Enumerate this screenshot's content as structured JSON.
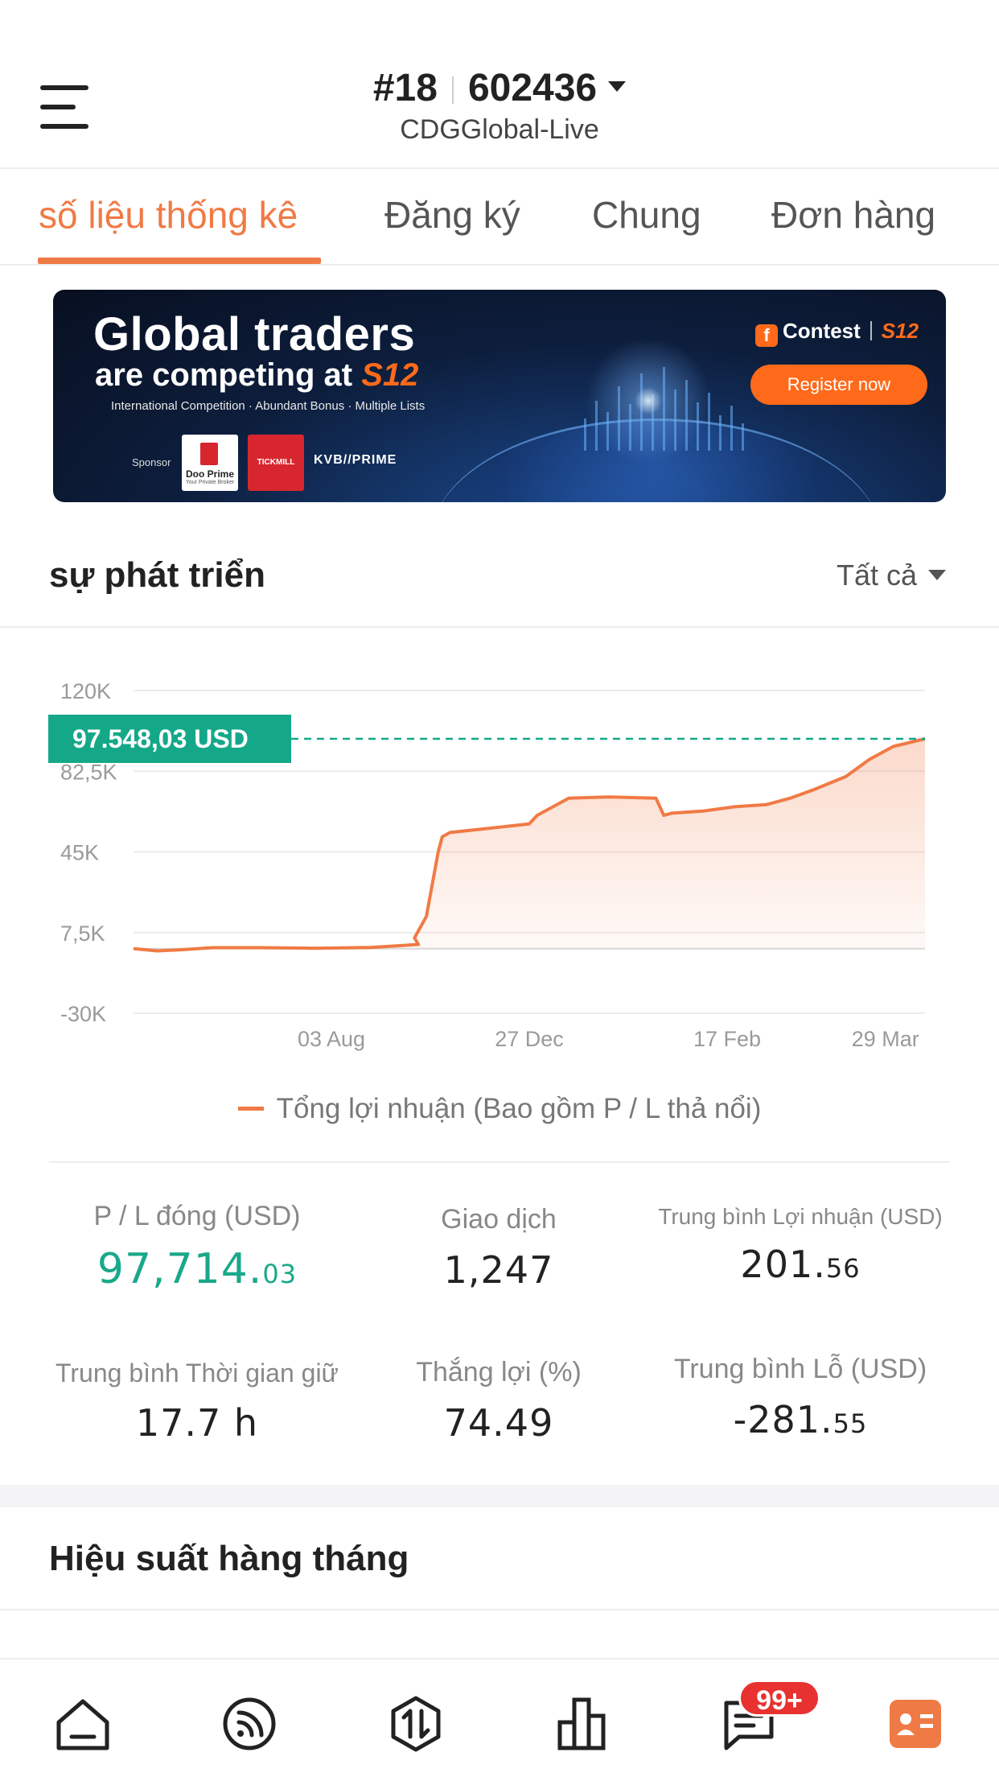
{
  "header": {
    "account_rank": "#18",
    "account_id": "602436",
    "server": "CDGGlobal-Live"
  },
  "tabs": [
    {
      "label": "số liệu thống kê",
      "active": true
    },
    {
      "label": "Đăng ký",
      "active": false
    },
    {
      "label": "Chung",
      "active": false
    },
    {
      "label": "Đơn hàng",
      "active": false
    }
  ],
  "banner": {
    "title_line1": "Global traders",
    "title_line2": "are competing at",
    "title_brand": "S12",
    "subtitle": "International Competition · Abundant Bonus · Multiple Lists",
    "sponsor_label": "Sponsor",
    "sponsor1": "Doo Prime",
    "sponsor1_tagline": "Your Private Broker",
    "sponsor2": "TICKMILL",
    "sponsor3": "KVB//PRIME",
    "contest_label": "Contest",
    "contest_brand": "S12",
    "cta": "Register now"
  },
  "growth": {
    "title": "sự phát triển",
    "filter_value": "Tất cả"
  },
  "chart_data": {
    "type": "area",
    "y_ticks": [
      "120K",
      "82,5K",
      "45K",
      "7,5K",
      "-30K"
    ],
    "x_ticks": [
      "03 Aug",
      "27 Dec",
      "17 Feb",
      "29 Mar"
    ],
    "ylim": [
      -30000,
      120000
    ],
    "current_value_label": "97.548,03  USD",
    "current_value": 97548.03,
    "series": [
      {
        "name": "Tổng lợi nhuận (Bao gồm P / L thả nổi)",
        "color": "#f07a45",
        "x": [
          0,
          0.03,
          0.06,
          0.1,
          0.16,
          0.23,
          0.3,
          0.36,
          0.355,
          0.37,
          0.375,
          0.385,
          0.39,
          0.4,
          0.45,
          0.5,
          0.51,
          0.55,
          0.6,
          0.66,
          0.67,
          0.68,
          0.72,
          0.76,
          0.8,
          0.83,
          0.86,
          0.9,
          0.93,
          0.96,
          1.0
        ],
        "values": [
          0,
          -1000,
          -500,
          500,
          500,
          200,
          600,
          2000,
          5000,
          15000,
          25000,
          45000,
          52000,
          54000,
          56000,
          58000,
          62000,
          70000,
          70500,
          70000,
          62000,
          63000,
          64000,
          66000,
          67000,
          70000,
          74000,
          80000,
          88000,
          94000,
          97548
        ]
      }
    ]
  },
  "stats": [
    {
      "label": "P / L đóng (USD)",
      "int": "97,714",
      "dec": "03"
    },
    {
      "label": "Giao dịch",
      "value": "1,247"
    },
    {
      "label": "Trung bình Lợi nhuận (USD)",
      "int": "201",
      "dec": "56"
    },
    {
      "label": "Trung bình Thời gian giữ",
      "value": "17.7 h"
    },
    {
      "label": "Thắng lợi (%)",
      "value": "74.49"
    },
    {
      "label": "Trung bình Lỗ (USD)",
      "int": "-281",
      "dec": "55"
    }
  ],
  "monthly": {
    "title": "Hiệu suất hàng tháng"
  },
  "bottom_nav": {
    "items": [
      "home-icon",
      "feed-icon",
      "trade-icon",
      "chart-icon",
      "messages-icon",
      "profile-icon"
    ],
    "badge": "99+",
    "accent": "#f07a45"
  }
}
